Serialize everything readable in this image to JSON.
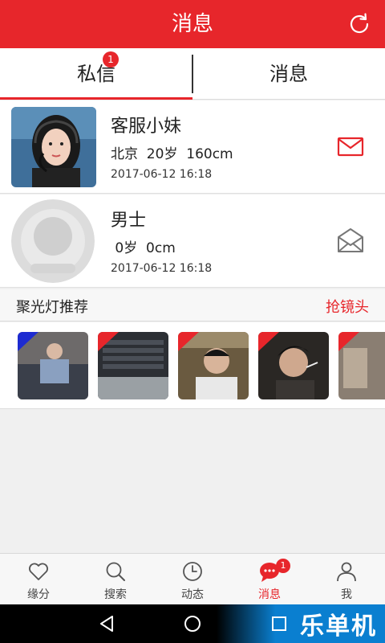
{
  "header": {
    "title": "消息",
    "refresh_icon": "refresh-icon"
  },
  "tabs": [
    {
      "label": "私信",
      "badge": "1",
      "active": true
    },
    {
      "label": "消息",
      "active": false
    }
  ],
  "messages": [
    {
      "name": "客服小妹",
      "meta": "北京  20岁  160cm",
      "time": "2017-06-12 16:18",
      "mail_state": "unread",
      "mail_color": "#e7262b"
    },
    {
      "name": "男士",
      "meta": " 0岁  0cm",
      "time": "2017-06-12 16:18",
      "mail_state": "read",
      "mail_color": "#777777"
    }
  ],
  "spotlight": {
    "label": "聚光灯推荐",
    "action": "抢镜头",
    "thumbs": [
      {
        "badge_color": "#1d2bd1"
      },
      {
        "badge_color": "#e7262b"
      },
      {
        "badge_color": "#e7262b"
      },
      {
        "badge_color": "#e7262b"
      },
      {
        "badge_color": "#e7262b"
      }
    ]
  },
  "tabbar": [
    {
      "label": "缘分",
      "icon": "heart-icon"
    },
    {
      "label": "搜索",
      "icon": "search-icon"
    },
    {
      "label": "动态",
      "icon": "clock-icon"
    },
    {
      "label": "消息",
      "icon": "chat-icon",
      "badge": "1",
      "active": true
    },
    {
      "label": "我",
      "icon": "person-icon"
    }
  ],
  "watermark": "乐单机",
  "colors": {
    "accent": "#e7262b",
    "bg": "#f0f0f0"
  }
}
